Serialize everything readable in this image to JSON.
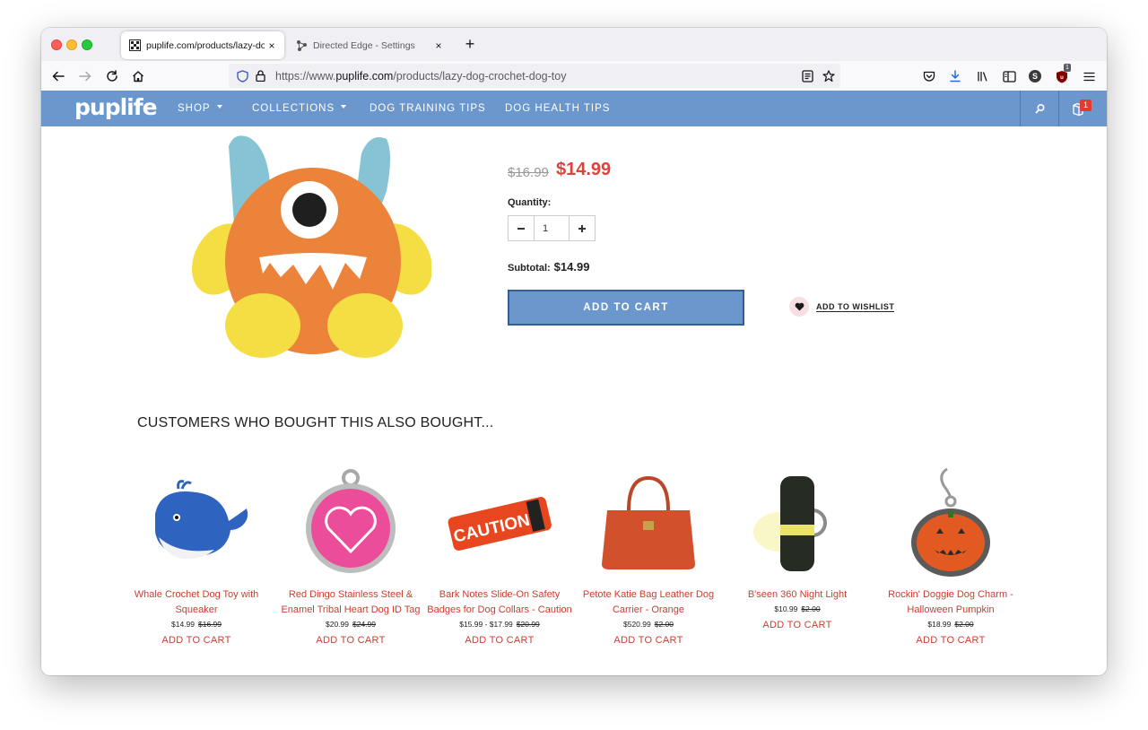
{
  "browser": {
    "tabs": [
      {
        "title": "puplife.com/products/lazy-dog-crochet-dog-toy",
        "close": "×"
      },
      {
        "title": "Directed Edge - Settings",
        "close": "×"
      }
    ],
    "new_tab": "+",
    "url_prefix": "https://www.",
    "url_domain": "puplife.com",
    "url_path": "/products/lazy-dog-crochet-dog-toy",
    "profile_initial": "S",
    "extension_badge": "1"
  },
  "site": {
    "logo": "puplife",
    "menu": [
      {
        "label": "SHOP"
      },
      {
        "label": "COLLECTIONS"
      },
      {
        "label": "DOG TRAINING TIPS"
      },
      {
        "label": "DOG HEALTH TIPS"
      }
    ],
    "cart_count": "1",
    "accent": "#6b97cc"
  },
  "product": {
    "old_price": "$16.99",
    "price": "$14.99",
    "quantity_label": "Quantity:",
    "quantity": "1",
    "subtotal_label": "Subtotal:",
    "subtotal": "$14.99",
    "add_to_cart": "ADD TO CART",
    "wishlist": "ADD TO WISHLIST"
  },
  "also_bought": {
    "title": "CUSTOMERS WHO BOUGHT THIS ALSO BOUGHT...",
    "items": [
      {
        "name": "Whale Crochet Dog Toy with Squeaker",
        "price": "$14.99",
        "old_price": "$16.99",
        "cta": "ADD TO CART"
      },
      {
        "name": "Red Dingo Stainless Steel & Enamel Tribal Heart Dog ID Tag",
        "price": "$20.99",
        "old_price": "$24.99",
        "cta": "ADD TO CART"
      },
      {
        "name": "Bark Notes Slide-On Safety Badges for Dog Collars - Caution",
        "price": "$15.99 - $17.99",
        "old_price": "$20.99",
        "cta": "ADD TO CART",
        "badge_text": "CAUTION"
      },
      {
        "name": "Petote Katie Bag Leather Dog Carrier - Orange",
        "price": "$520.99",
        "old_price": "$2.00",
        "cta": "ADD TO CART"
      },
      {
        "name": "B'seen 360 Night Light",
        "price": "$10.99",
        "old_price": "$2.00",
        "cta": "ADD TO CART"
      },
      {
        "name": "Rockin' Doggie Dog Charm - Halloween Pumpkin",
        "price": "$18.99",
        "old_price": "$2.00",
        "cta": "ADD TO CART"
      }
    ]
  }
}
